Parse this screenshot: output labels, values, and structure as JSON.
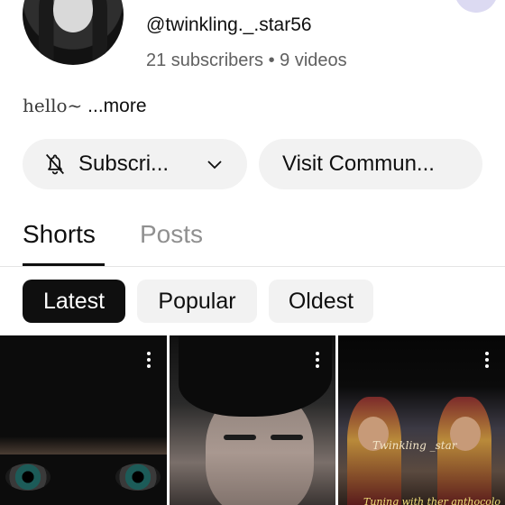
{
  "channel": {
    "handle": "@twinkling._.star56",
    "meta": "21 subscribers • 9 videos",
    "bio_text": "hello~",
    "bio_more": "...more"
  },
  "actions": {
    "subscribe_label": "Subscri...",
    "visit_label": "Visit Commun..."
  },
  "tabs": [
    {
      "label": "Shorts",
      "selected": true
    },
    {
      "label": "Posts",
      "selected": false
    }
  ],
  "filters": [
    {
      "label": "Latest",
      "selected": true
    },
    {
      "label": "Popular",
      "selected": false
    },
    {
      "label": "Oldest",
      "selected": false
    }
  ],
  "thumbnails": [
    {
      "icon": "more-vert-icon"
    },
    {
      "icon": "more-vert-icon"
    },
    {
      "icon": "more-vert-icon",
      "overlay_title": "Twinkling _star",
      "overlay_caption": "Tuning with ther anthocolo"
    }
  ],
  "colors": {
    "chip_selected_bg": "#0f0f0f",
    "chip_bg": "#f2f2f2",
    "secondary_text": "#606060",
    "inactive_tab": "#909090"
  }
}
